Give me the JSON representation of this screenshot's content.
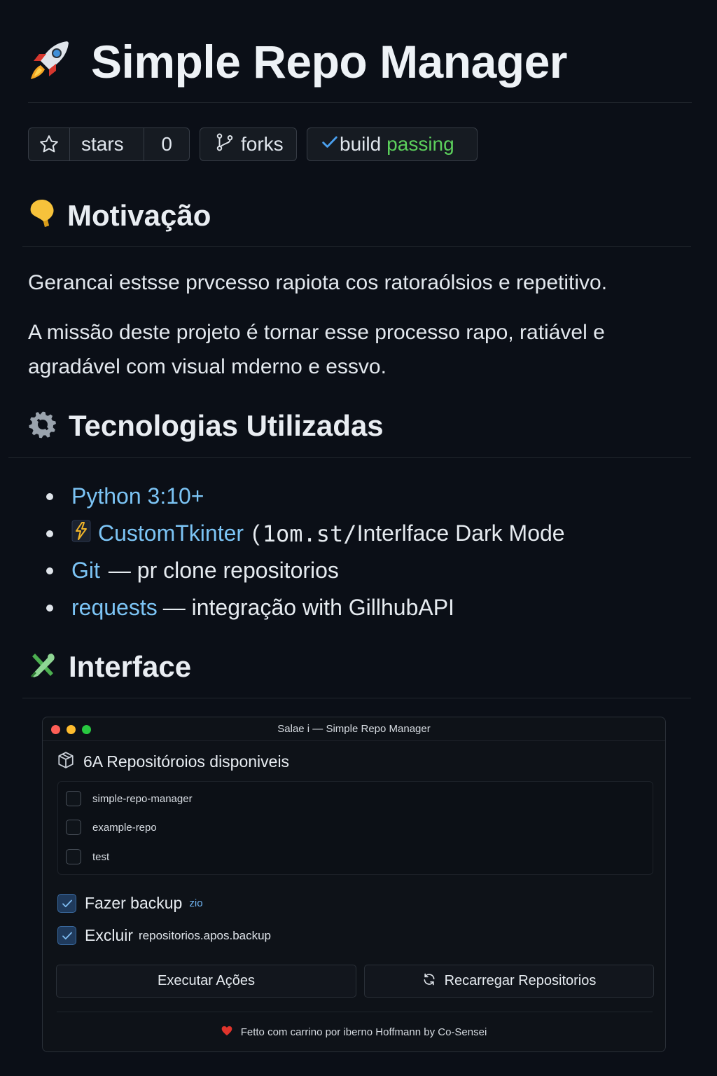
{
  "title": "Simple Repo Manager",
  "badges": {
    "stars_label": "stars",
    "stars_count": "0",
    "forks_label": "forks",
    "build_label": "build",
    "build_status": "passing"
  },
  "sections": {
    "motivation": "Motivação",
    "technologies": "Tecnologias Utilizadas",
    "interface": "Interface"
  },
  "paragraphs": {
    "p1": "Gerancai estsse prvcesso rapiota cos ratoraólsios e repetitivo.",
    "p2": "A missão deste projeto é tornar esse processo rapo, ratiável e agradável com visual mderno e essvo."
  },
  "tech": [
    {
      "name": "Python 3:10+",
      "desc": ""
    },
    {
      "name": "CustomTkinter",
      "desc_prefix": "(",
      "desc_mono": "1om.st/",
      "desc": "Interlface Dark Mode"
    },
    {
      "name": "Git",
      "desc": "— pr clone repositorios"
    },
    {
      "name": "requests",
      "desc": "— integração with GillhubAPI"
    }
  ],
  "app": {
    "window_title": "Salae i — Simple Repo Manager",
    "repos_header": "6A Repositóroios disponiveis",
    "repos": [
      "simple-repo-manager",
      "example-repo",
      "test"
    ],
    "option_backup": "Fazer backup",
    "option_backup_note": "zio",
    "option_delete": "Excluir",
    "option_delete_note": "repositorios.apos.backup",
    "btn_execute": "Executar Ações",
    "btn_reload": "Recarregar Repositorios",
    "footer": "Fetto com carrino por iberno Hoffmann by Co-Sensei"
  },
  "colors": {
    "background": "#0b0f17",
    "link": "#7cc4f5",
    "passing": "#5cd05c",
    "checkbox_on": "#1f3a5c"
  },
  "icons": {
    "title": "rocket-icon",
    "motivation": "lightbulb-icon",
    "technologies": "gear-icon",
    "interface": "tools-icon"
  }
}
